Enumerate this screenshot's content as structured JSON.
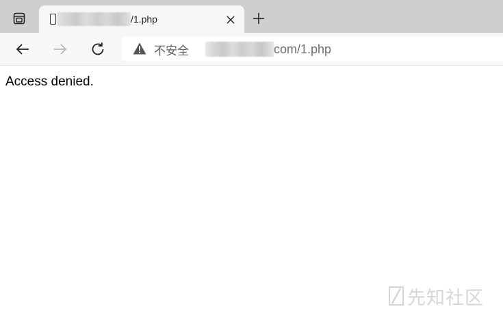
{
  "tab": {
    "title": "/1.php"
  },
  "toolbar": {
    "security_label": "不安全",
    "url_suffix": "com/1.php"
  },
  "page": {
    "message": "Access denied."
  },
  "watermark": {
    "text": "先知社区"
  },
  "colors": {
    "tabstrip_bg": "#cfcfcf",
    "toolbar_bg": "#f7f7f7",
    "omnibox_bg": "#ffffff",
    "muted_text": "#707070"
  }
}
